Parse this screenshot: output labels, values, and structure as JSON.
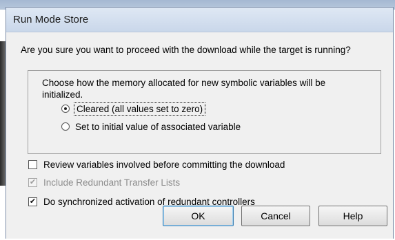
{
  "window": {
    "title": "Run Mode Store"
  },
  "dialog": {
    "question": "Are you sure you want to proceed with the download while the target is running?",
    "memory_group": {
      "description": "Choose how the memory allocated for new symbolic variables will be initialized.",
      "options": [
        {
          "label": "Cleared (all values set to zero)",
          "selected": true
        },
        {
          "label": "Set to initial value of associated variable",
          "selected": false
        }
      ]
    },
    "checkboxes": [
      {
        "label": "Review variables involved before committing the download",
        "checked": false,
        "enabled": true
      },
      {
        "label": "Include Redundant Transfer Lists",
        "checked": true,
        "enabled": false
      },
      {
        "label": "Do synchronized activation of redundant controllers",
        "checked": true,
        "enabled": true
      }
    ],
    "buttons": {
      "ok": "OK",
      "cancel": "Cancel",
      "help": "Help"
    }
  },
  "icons": {
    "check_mark": "✔"
  }
}
